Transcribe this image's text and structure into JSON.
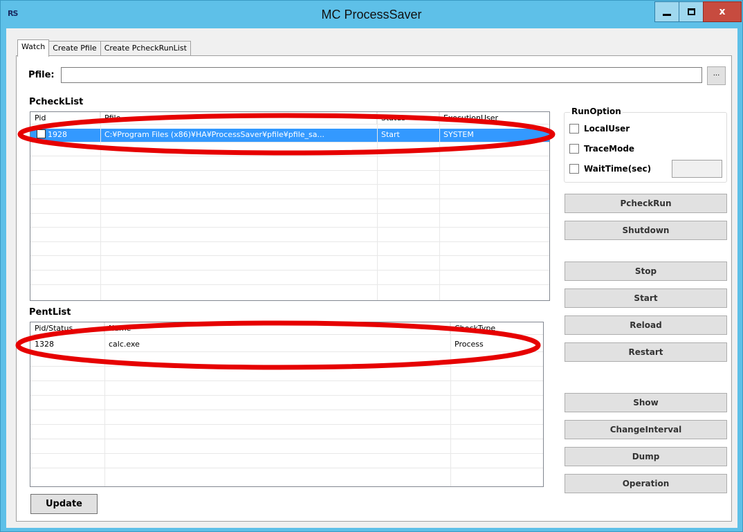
{
  "window": {
    "app_icon_text": "RS",
    "title": "MC ProcessSaver",
    "close_glyph": "x"
  },
  "tabs": [
    {
      "label": "Watch",
      "active": true
    },
    {
      "label": "Create Pfile",
      "active": false
    },
    {
      "label": "Create PcheckRunList",
      "active": false
    }
  ],
  "pfile": {
    "label": "Pfile:",
    "value": "",
    "browse_label": "..."
  },
  "pcheck_list": {
    "label": "PcheckList",
    "columns": [
      "Pid",
      "Pfile",
      "Status",
      "ExecutionUser"
    ],
    "rows": [
      {
        "checked": false,
        "pid": "1928",
        "pfile": "C:¥Program Files (x86)¥HA¥ProcessSaver¥pfile¥pfile_sa...",
        "status": "Start",
        "user": "SYSTEM",
        "selected": true
      }
    ]
  },
  "pent_list": {
    "label": "PentList",
    "columns": [
      "Pid/Status",
      "Name",
      "CheckType"
    ],
    "rows": [
      {
        "pid": "1328",
        "name": "calc.exe",
        "type": "Process"
      }
    ]
  },
  "run_option": {
    "title": "RunOption",
    "local_user": "LocalUser",
    "trace_mode": "TraceMode",
    "wait_time": "WaitTime(sec)",
    "wait_time_value": ""
  },
  "buttons": {
    "pcheck_run": "PcheckRun",
    "shutdown": "Shutdown",
    "stop": "Stop",
    "start": "Start",
    "reload": "Reload",
    "restart": "Restart",
    "show": "Show",
    "change_interval": "ChangeInterval",
    "dump": "Dump",
    "operation": "Operation",
    "update": "Update"
  },
  "annotation_color": "#e60000"
}
